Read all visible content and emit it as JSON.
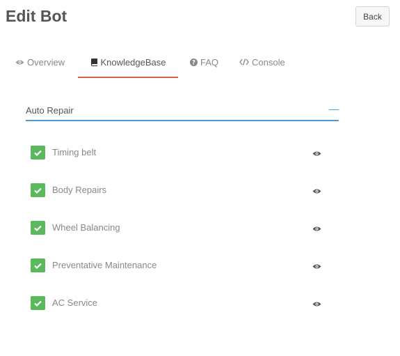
{
  "header": {
    "title": "Edit Bot",
    "back_label": "Back"
  },
  "tabs": [
    {
      "label": "Overview",
      "icon": "eye-icon",
      "active": false
    },
    {
      "label": "KnowledgeBase",
      "icon": "book-icon",
      "active": true
    },
    {
      "label": "FAQ",
      "icon": "question-circle-icon",
      "active": false
    },
    {
      "label": "Console",
      "icon": "code-icon",
      "active": false
    }
  ],
  "colors": {
    "accent_tab": "#d4663f",
    "field_underline": "#4a9bd9",
    "checkbox": "#5cb85c"
  },
  "category": {
    "label": "Auto Repair",
    "toggle_symbol": "—"
  },
  "items": [
    {
      "label": "Timing belt",
      "checked": true
    },
    {
      "label": "Body Repairs",
      "checked": true
    },
    {
      "label": "Wheel Balancing",
      "checked": true
    },
    {
      "label": "Preventative Maintenance",
      "checked": true
    },
    {
      "label": "AC Service",
      "checked": true
    }
  ]
}
